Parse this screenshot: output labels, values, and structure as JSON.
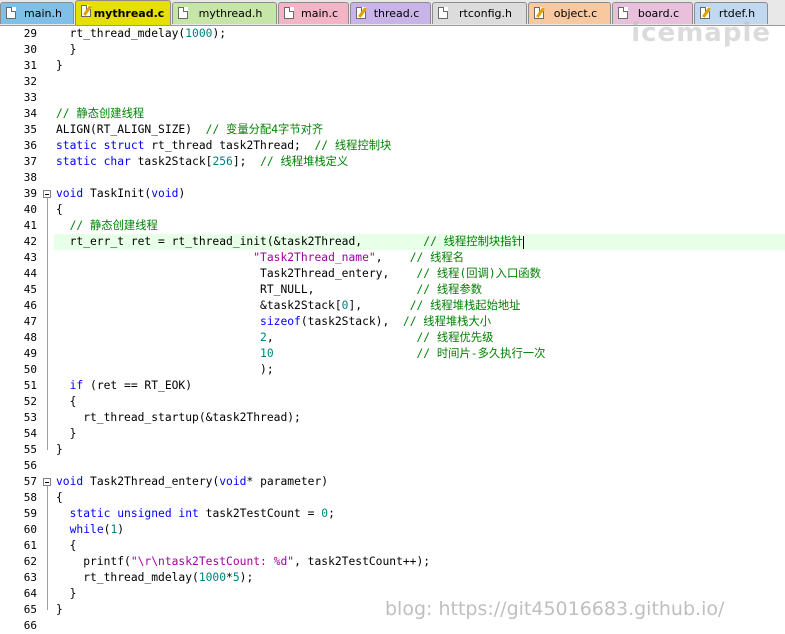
{
  "tabs": [
    {
      "label": "main.h",
      "color": "#7fc0e8",
      "active": false,
      "icon": "file-icon"
    },
    {
      "label": "mythread.c",
      "color": "#e6e000",
      "active": true,
      "icon": "edit-file-icon"
    },
    {
      "label": "mythread.h",
      "color": "#c6e6a8",
      "active": false,
      "icon": "file-icon"
    },
    {
      "label": "main.c",
      "color": "#f4b4c8",
      "active": false,
      "icon": "file-icon"
    },
    {
      "label": "thread.c",
      "color": "#c8b4e8",
      "active": false,
      "icon": "edit-file-icon"
    },
    {
      "label": "rtconfig.h",
      "color": "#dcdcdc",
      "active": false,
      "icon": "file-icon"
    },
    {
      "label": "object.c",
      "color": "#f8c8a0",
      "active": false,
      "icon": "edit-file-icon"
    },
    {
      "label": "board.c",
      "color": "#e8c0dc",
      "active": false,
      "icon": "file-icon"
    },
    {
      "label": "rtdef.h",
      "color": "#c0d8f0",
      "active": false,
      "icon": "edit-file-icon"
    }
  ],
  "current_line": 41,
  "fold_markers": [
    39,
    57
  ],
  "lines": [
    {
      "n": "29",
      "code": [
        [
          "  rt_thread_mdelay(",
          "p"
        ],
        [
          "1000",
          "nm"
        ],
        [
          ");",
          "p"
        ]
      ]
    },
    {
      "n": "30",
      "code": [
        [
          "  }",
          "p"
        ]
      ]
    },
    {
      "n": "31",
      "code": [
        [
          "}",
          "p"
        ]
      ]
    },
    {
      "n": "32",
      "code": []
    },
    {
      "n": "33",
      "code": []
    },
    {
      "n": "34",
      "code": [
        [
          "// 静态创建线程",
          "cm"
        ]
      ]
    },
    {
      "n": "35",
      "code": [
        [
          "ALIGN(RT_ALIGN_SIZE)  ",
          "p"
        ],
        [
          "// 变量分配4字节对齐",
          "cm"
        ]
      ]
    },
    {
      "n": "36",
      "code": [
        [
          "static struct",
          "kw"
        ],
        [
          " rt_thread task2Thread;  ",
          "p"
        ],
        [
          "// 线程控制块",
          "cm"
        ]
      ]
    },
    {
      "n": "37",
      "code": [
        [
          "static char",
          "kw"
        ],
        [
          " task2Stack[",
          "p"
        ],
        [
          "256",
          "nm"
        ],
        [
          "];  ",
          "p"
        ],
        [
          "// 线程堆栈定义",
          "cm"
        ]
      ]
    },
    {
      "n": "38",
      "code": []
    },
    {
      "n": "39",
      "code": [
        [
          "void",
          "kw"
        ],
        [
          " TaskInit(",
          "p"
        ],
        [
          "void",
          "kw"
        ],
        [
          ")",
          "p"
        ]
      ]
    },
    {
      "n": "40",
      "code": [
        [
          "{",
          "p"
        ]
      ]
    },
    {
      "n": "41",
      "code": [
        [
          "  ",
          "p"
        ],
        [
          "// 静态创建线程",
          "cm"
        ]
      ]
    },
    {
      "n": "42",
      "code": [
        [
          "  rt_err_t ret = rt_thread_init(&task2Thread,         ",
          "p"
        ],
        [
          "// 线程控制块指针",
          "cm"
        ]
      ]
    },
    {
      "n": "43",
      "code": [
        [
          "                             ",
          "p"
        ],
        [
          "\"Task2Thread_name\"",
          "st"
        ],
        [
          ",    ",
          "p"
        ],
        [
          "// 线程名",
          "cm"
        ]
      ]
    },
    {
      "n": "44",
      "code": [
        [
          "                              Task2Thread_entery,    ",
          "p"
        ],
        [
          "// 线程(回调)入口函数",
          "cm"
        ]
      ]
    },
    {
      "n": "45",
      "code": [
        [
          "                              RT_NULL,               ",
          "p"
        ],
        [
          "// 线程参数",
          "cm"
        ]
      ]
    },
    {
      "n": "46",
      "code": [
        [
          "                              &task2Stack[",
          "p"
        ],
        [
          "0",
          "nm"
        ],
        [
          "],       ",
          "p"
        ],
        [
          "// 线程堆栈起始地址",
          "cm"
        ]
      ]
    },
    {
      "n": "47",
      "code": [
        [
          "                              ",
          "p"
        ],
        [
          "sizeof",
          "kw"
        ],
        [
          "(task2Stack),  ",
          "p"
        ],
        [
          "// 线程堆栈大小",
          "cm"
        ]
      ]
    },
    {
      "n": "48",
      "code": [
        [
          "                              ",
          "p"
        ],
        [
          "2",
          "nm"
        ],
        [
          ",                     ",
          "p"
        ],
        [
          "// 线程优先级",
          "cm"
        ]
      ]
    },
    {
      "n": "49",
      "code": [
        [
          "                              ",
          "p"
        ],
        [
          "10",
          "nm"
        ],
        [
          "                     ",
          "p"
        ],
        [
          "// 时间片-多久执行一次",
          "cm"
        ]
      ]
    },
    {
      "n": "50",
      "code": [
        [
          "                              );",
          "p"
        ]
      ]
    },
    {
      "n": "51",
      "code": [
        [
          "  ",
          "p"
        ],
        [
          "if",
          "kw"
        ],
        [
          " (ret == RT_EOK)",
          "p"
        ]
      ]
    },
    {
      "n": "52",
      "code": [
        [
          "  {",
          "p"
        ]
      ]
    },
    {
      "n": "53",
      "code": [
        [
          "    rt_thread_startup(&task2Thread);",
          "p"
        ]
      ]
    },
    {
      "n": "54",
      "code": [
        [
          "  }",
          "p"
        ]
      ]
    },
    {
      "n": "55",
      "code": [
        [
          "}",
          "p"
        ]
      ]
    },
    {
      "n": "56",
      "code": []
    },
    {
      "n": "57",
      "code": [
        [
          "void",
          "kw"
        ],
        [
          " Task2Thread_entery(",
          "p"
        ],
        [
          "void",
          "kw"
        ],
        [
          "* parameter)",
          "p"
        ]
      ]
    },
    {
      "n": "58",
      "code": [
        [
          "{",
          "p"
        ]
      ]
    },
    {
      "n": "59",
      "code": [
        [
          "  ",
          "p"
        ],
        [
          "static unsigned int",
          "kw"
        ],
        [
          " task2TestCount = ",
          "p"
        ],
        [
          "0",
          "nm"
        ],
        [
          ";",
          "p"
        ]
      ]
    },
    {
      "n": "60",
      "code": [
        [
          "  ",
          "p"
        ],
        [
          "while",
          "kw"
        ],
        [
          "(",
          "p"
        ],
        [
          "1",
          "nm"
        ],
        [
          ")",
          "p"
        ]
      ]
    },
    {
      "n": "61",
      "code": [
        [
          "  {",
          "p"
        ]
      ]
    },
    {
      "n": "62",
      "code": [
        [
          "    printf(",
          "p"
        ],
        [
          "\"\\r\\ntask2TestCount: %d\"",
          "st"
        ],
        [
          ", task2TestCount++);",
          "p"
        ]
      ]
    },
    {
      "n": "63",
      "code": [
        [
          "    rt_thread_mdelay(",
          "p"
        ],
        [
          "1000",
          "nm"
        ],
        [
          "*",
          "p"
        ],
        [
          "5",
          "nm"
        ],
        [
          ");",
          "p"
        ]
      ]
    },
    {
      "n": "64",
      "code": [
        [
          "  }",
          "p"
        ]
      ]
    },
    {
      "n": "65",
      "code": [
        [
          "}",
          "p"
        ]
      ]
    },
    {
      "n": "66",
      "code": []
    }
  ],
  "watermarks": {
    "top_right": "icemaple",
    "bottom": "blog: https://git45016683.github.io/"
  }
}
